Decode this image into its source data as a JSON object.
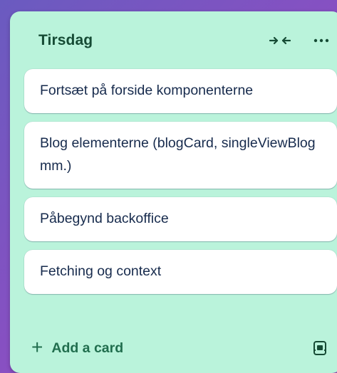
{
  "list": {
    "title": "Tirsdag",
    "header_icons": [
      "collapse-icon",
      "more-options-icon"
    ],
    "cards": [
      {
        "title": "Fortsæt på forside komponenterne"
      },
      {
        "title": "Blog elementerne (blogCard, singleViewBlog mm.)"
      },
      {
        "title": "Påbegynd backoffice"
      },
      {
        "title": "Fetching og context"
      }
    ],
    "footer": {
      "add_card_label": "Add a card",
      "add_icon": "plus-icon",
      "template_icon": "card-template-icon"
    }
  },
  "colors": {
    "list_background": "#baf3db",
    "title_text": "#164b35",
    "accent_green": "#216e4e",
    "card_text": "#172b4d",
    "board_background": "#8a4fc2"
  }
}
